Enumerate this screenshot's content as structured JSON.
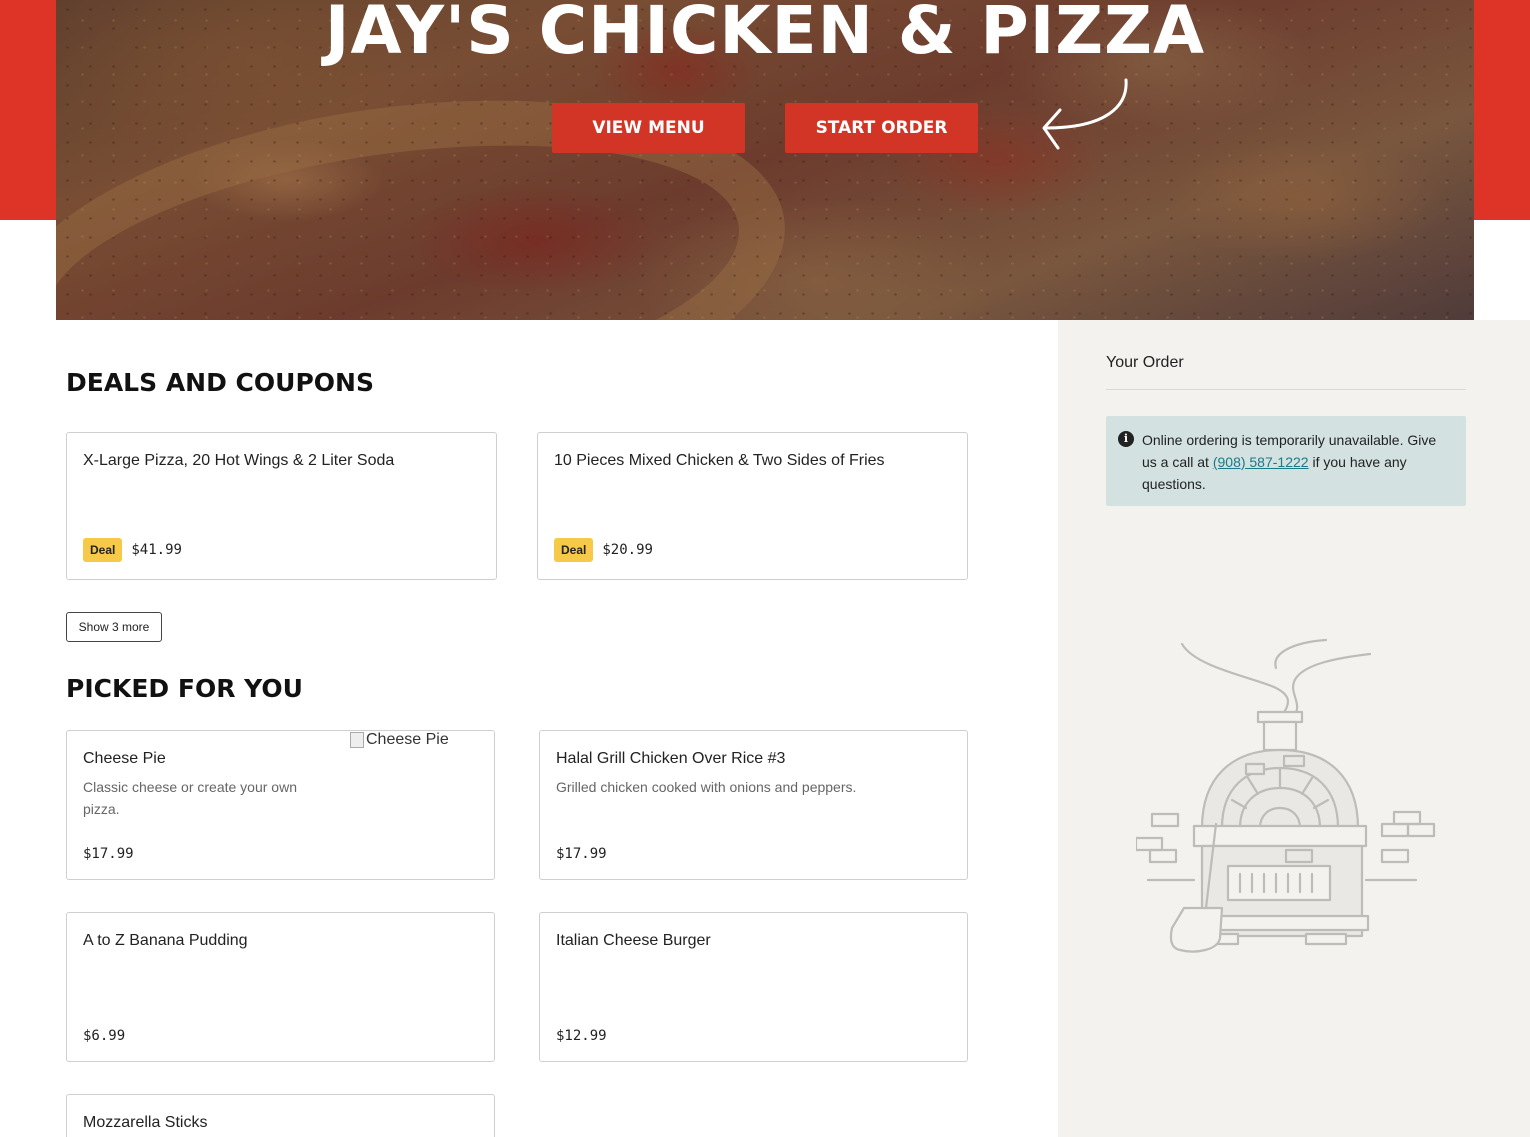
{
  "hero": {
    "title": "JAY'S CHICKEN & PIZZA",
    "view_menu": "VIEW MENU",
    "start_order": "START ORDER"
  },
  "deals": {
    "title": "DEALS AND COUPONS",
    "items": [
      {
        "name": "X-Large Pizza, 20 Hot Wings & 2 Liter Soda",
        "badge": "Deal",
        "price": "$41.99"
      },
      {
        "name": "10 Pieces Mixed Chicken & Two Sides of Fries",
        "badge": "Deal",
        "price": "$20.99"
      }
    ],
    "show_more": "Show 3 more"
  },
  "picked": {
    "title": "PICKED FOR YOU",
    "items": [
      {
        "name": "Cheese Pie",
        "description": "Classic cheese or create your own pizza.",
        "price": "$17.99",
        "image_alt": "Cheese Pie"
      },
      {
        "name": "Halal Grill Chicken Over Rice #3",
        "description": "Grilled chicken cooked with onions and peppers.",
        "price": "$17.99"
      },
      {
        "name": "A to Z Banana Pudding",
        "description": "",
        "price": "$6.99"
      },
      {
        "name": "Italian Cheese Burger",
        "description": "",
        "price": "$12.99"
      },
      {
        "name": "Mozzarella Sticks",
        "description": "",
        "price": ""
      }
    ]
  },
  "order": {
    "title": "Your Order",
    "notice_before": "Online ordering is temporarily unavailable. Give us a call at ",
    "phone": "(908) 587-1222",
    "notice_after": " if you have any questions."
  },
  "colors": {
    "brand_red": "#dd3427",
    "deal_yellow": "#f7c948",
    "notice_bg": "#d3e2e1",
    "link": "#1a7a86"
  },
  "icons": [
    "arrow-icon",
    "info-icon",
    "pizza-oven-illustration"
  ]
}
